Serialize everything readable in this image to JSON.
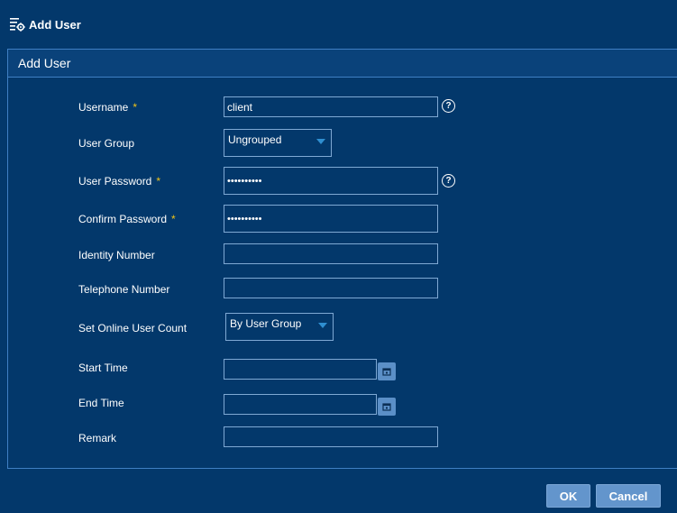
{
  "header": {
    "title": "Add User",
    "icon": "settings-list-icon"
  },
  "panel": {
    "title": "Add User"
  },
  "form": {
    "username": {
      "label": "Username",
      "required": "*",
      "value": "client"
    },
    "user_group": {
      "label": "User Group",
      "value": "Ungrouped"
    },
    "user_password": {
      "label": "User Password",
      "required": "*",
      "value": "••••••••••"
    },
    "confirm_password": {
      "label": "Confirm Password",
      "required": "*",
      "value": "••••••••••"
    },
    "identity_number": {
      "label": "Identity Number",
      "value": ""
    },
    "telephone_number": {
      "label": "Telephone Number",
      "value": ""
    },
    "online_user_count": {
      "label": "Set Online User Count",
      "value": "By User Group"
    },
    "start_time": {
      "label": "Start Time",
      "value": ""
    },
    "end_time": {
      "label": "End Time",
      "value": ""
    },
    "remark": {
      "label": "Remark",
      "value": ""
    }
  },
  "help_glyph": "?",
  "buttons": {
    "ok": "OK",
    "cancel": "Cancel"
  },
  "colors": {
    "background": "#03386b",
    "border": "#3f7fc3",
    "button": "#6395cc",
    "required": "#f0c419"
  }
}
